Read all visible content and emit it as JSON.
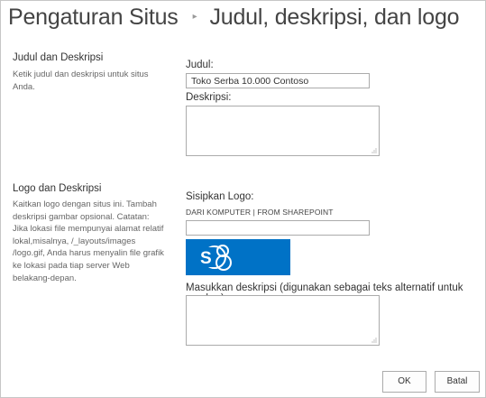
{
  "header": {
    "breadcrumb_root": "Pengaturan Situs",
    "separator": "▸",
    "page_title": "Judul, deskripsi, dan logo"
  },
  "title_section": {
    "heading": "Judul dan Deskripsi",
    "description": "Ketik judul dan deskripsi untuk situs Anda.",
    "title_label": "Judul:",
    "title_value": "Toko Serba 10.000 Contoso",
    "description_label": "Deskripsi:",
    "description_value": ""
  },
  "logo_section": {
    "heading": "Logo dan Deskripsi",
    "description": "Kaitkan logo dengan situs ini. Tambah deskripsi gambar opsional. Catatan: Jika lokasi file mempunyai alamat relatif lokal,misalnya, /_layouts/images /logo.gif, Anda harus menyalin file grafik ke lokasi pada tiap server Web belakang-depan.",
    "insert_logo_label": "Sisipkan Logo:",
    "from_computer": "DARI KOMPUTER",
    "link_separator": "|",
    "from_sharepoint": "FROM SHAREPOINT",
    "logo_url_value": "",
    "logo_icon": "sharepoint-logo-icon",
    "logo_color": "#0072c6",
    "alt_text_label": "Masukkan deskripsi (digunakan sebagai teks alternatif untuk gambar):",
    "alt_text_value": ""
  },
  "actions": {
    "ok_label": "OK",
    "cancel_label": "Batal"
  }
}
